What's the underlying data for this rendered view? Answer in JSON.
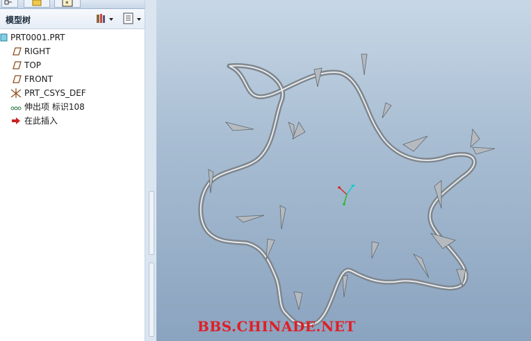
{
  "panel": {
    "title": "模型树"
  },
  "tree": {
    "items": [
      {
        "label": "PRT0001.PRT",
        "icon": "part-icon"
      },
      {
        "label": "RIGHT",
        "icon": "datum-plane-icon"
      },
      {
        "label": "TOP",
        "icon": "datum-plane-icon"
      },
      {
        "label": "FRONT",
        "icon": "datum-plane-icon"
      },
      {
        "label": "PRT_CSYS_DEF",
        "icon": "coordinate-system-icon"
      },
      {
        "label": "伸出项 标识108",
        "icon": "protrusion-icon"
      },
      {
        "label": "在此插入",
        "icon": "insert-here-arrow-icon"
      }
    ]
  },
  "watermark": "BBS.CHINADE.NET",
  "colors": {
    "viewport_top": "#c7d7e6",
    "viewport_bottom": "#8aa3bf",
    "model": "#8f959b",
    "watermark": "#e01e26"
  }
}
